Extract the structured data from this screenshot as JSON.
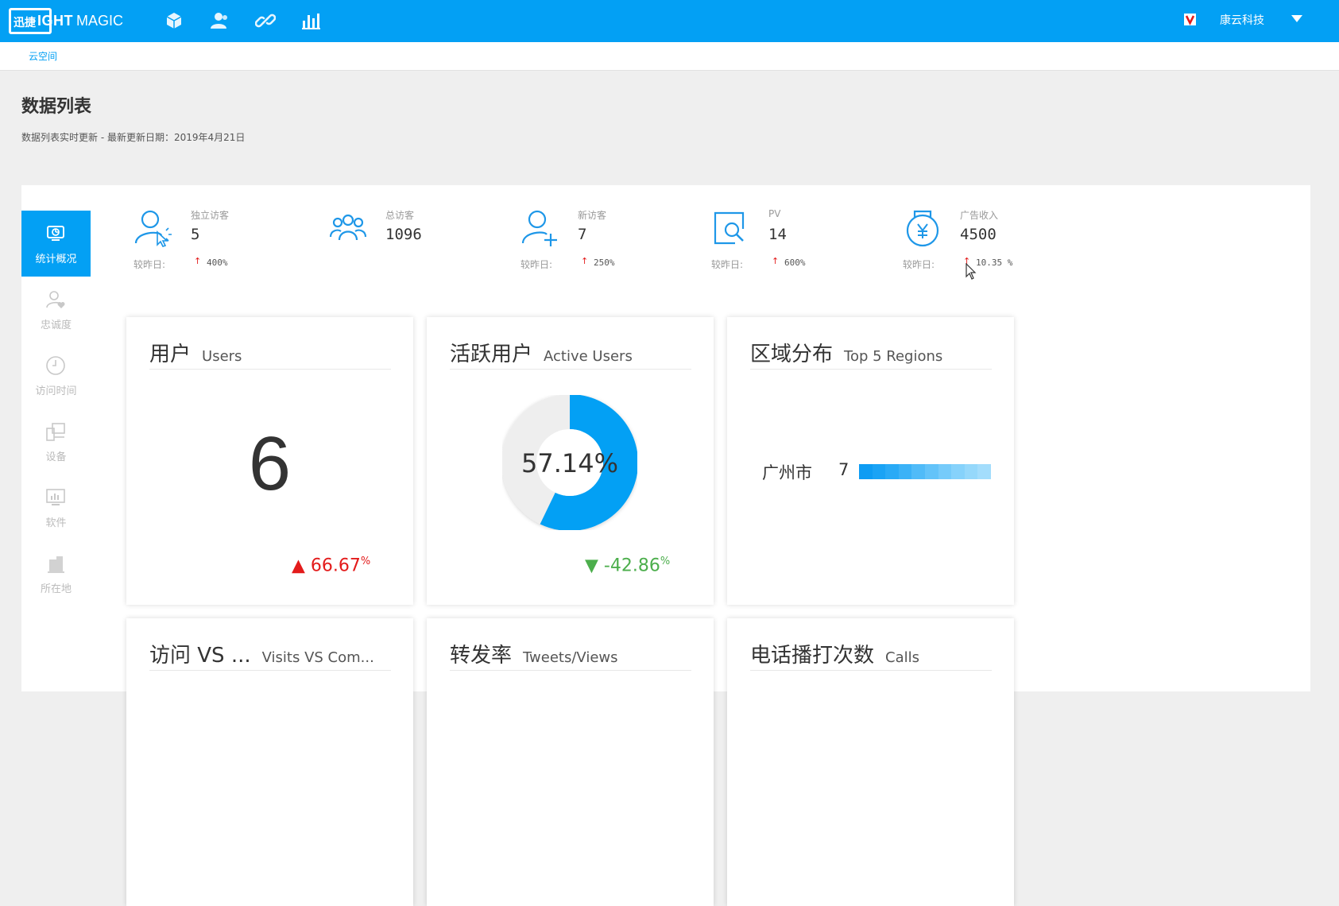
{
  "app": {
    "logo_cn": "迅捷",
    "logo_light": "IGHT",
    "logo_magic": "MAGIC",
    "nav_icons": [
      "cube-icon",
      "users-icon",
      "link-icon",
      "bar-chart-icon"
    ],
    "company": "康云科技"
  },
  "breadcrumb": {
    "item": "云空间"
  },
  "page": {
    "title": "数据列表",
    "subtitle": "数据列表实时更新 - 最新更新日期：2019年4月21日"
  },
  "sidenav": [
    {
      "label": "统计概况",
      "icon": "monitor-chart-icon",
      "active": true
    },
    {
      "label": "忠诚度",
      "icon": "user-heart-icon",
      "active": false
    },
    {
      "label": "访问时间",
      "icon": "clock-icon",
      "active": false
    },
    {
      "label": "设备",
      "icon": "devices-icon",
      "active": false
    },
    {
      "label": "软件",
      "icon": "software-icon",
      "active": false
    },
    {
      "label": "所在地",
      "icon": "building-icon",
      "active": false
    }
  ],
  "stats": [
    {
      "label": "独立访客",
      "value": "5",
      "compare_label": "较昨日:",
      "arrow": "↑",
      "pct": "400%",
      "icon": "user-click-icon"
    },
    {
      "label": "总访客",
      "value": "1096",
      "icon": "group-icon"
    },
    {
      "label": "新访客",
      "value": "7",
      "compare_label": "较昨日:",
      "arrow": "↑",
      "pct": "250%",
      "icon": "user-add-icon"
    },
    {
      "label": "PV",
      "value": "14",
      "compare_label": "较昨日:",
      "arrow": "↑",
      "pct": "600%",
      "icon": "page-search-icon"
    },
    {
      "label": "广告收入",
      "value": "4500",
      "compare_label": "较昨日:",
      "arrow": "↑",
      "pct": "10.35 %",
      "icon": "money-bag-icon"
    }
  ],
  "cards": {
    "users": {
      "title_cn": "用户",
      "title_en": "Users",
      "value": "6",
      "delta": "66.67",
      "delta_unit": "%",
      "delta_arrow": "▲"
    },
    "active": {
      "title_cn": "活跃用户",
      "title_en": "Active Users",
      "center_label": "57.14%",
      "active_fraction": 0.5714,
      "delta": "-42.86",
      "delta_unit": "%",
      "delta_arrow": "▼"
    },
    "regions": {
      "title_cn": "区域分布",
      "title_en": "Top 5 Regions",
      "items": [
        {
          "name": "广州市",
          "value": "7"
        }
      ]
    },
    "visits": {
      "title_cn": "访问 VS ...",
      "title_en": "Visits VS Com..."
    },
    "tweets": {
      "title_cn": "转发率",
      "title_en": "Tweets/Views"
    },
    "calls": {
      "title_cn": "电话播打次数",
      "title_en": "Calls"
    }
  },
  "colors": {
    "accent": "#03a0f4",
    "up": "#e31b1b",
    "down": "#4cae4c"
  }
}
